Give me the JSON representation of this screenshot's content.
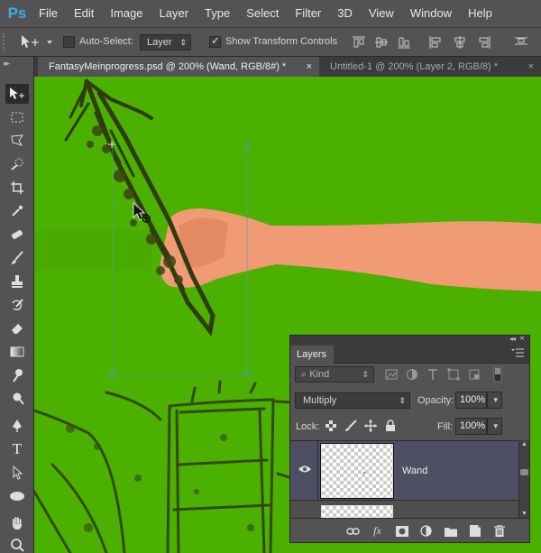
{
  "app": {
    "logo": "Ps"
  },
  "menu": [
    "File",
    "Edit",
    "Image",
    "Layer",
    "Type",
    "Select",
    "Filter",
    "3D",
    "View",
    "Window",
    "Help"
  ],
  "options": {
    "auto_select_label": "Auto-Select:",
    "auto_select_checked": false,
    "auto_select_target": "Layer",
    "transform_controls_label": "Show Transform Controls",
    "transform_controls_checked": true
  },
  "tabs": [
    {
      "title": "FantasyMeinprogress.psd @ 200% (Wand, RGB/8#) *",
      "active": true,
      "close": "×"
    },
    {
      "title": "Untitled-1 @ 200% (Layer 2, RGB/8) *",
      "active": false,
      "close": "×"
    }
  ],
  "tools": [
    "move-tool",
    "rectangular-marquee-tool",
    "polygonal-lasso-tool",
    "quick-selection-tool",
    "crop-tool",
    "eyedropper-tool",
    "spot-healing-brush-tool",
    "brush-tool",
    "clone-stamp-tool",
    "history-brush-tool",
    "eraser-tool",
    "gradient-tool",
    "smudge-tool",
    "dodge-tool",
    "pen-tool",
    "type-tool",
    "path-selection-tool",
    "ellipse-tool",
    "hand-tool",
    "zoom-tool"
  ],
  "tool_glyphs": {
    "type-tool": "T"
  },
  "colors": {
    "canvas": "#4bb000",
    "ui_panel": "#535353",
    "ui_dark": "#282828",
    "selected_layer": "#4f4f63",
    "logo": "#3fa9f5"
  },
  "layers_panel": {
    "title": "Layers",
    "filter": {
      "label": "Kind",
      "arrow": "⇕"
    },
    "blend_mode": "Multiply",
    "opacity_label": "Opacity:",
    "opacity": "100%",
    "lock_label": "Lock:",
    "fill_label": "Fill:",
    "fill": "100%",
    "layers": [
      {
        "name": "Wand",
        "visible": true,
        "selected": true
      }
    ],
    "footer_glyphs": {
      "fx": "fx"
    }
  }
}
